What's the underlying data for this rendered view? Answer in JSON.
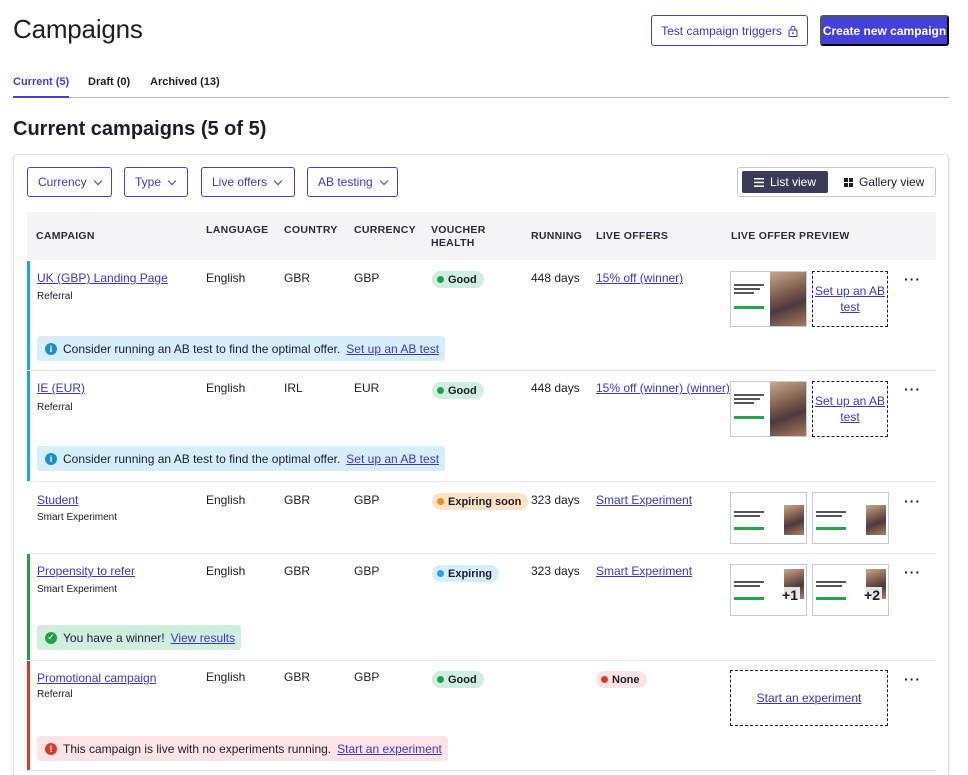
{
  "header": {
    "title": "Campaigns",
    "test_triggers_label": "Test campaign triggers",
    "create_label": "Create new campaign"
  },
  "tabs": [
    {
      "label": "Current (5)",
      "active": true
    },
    {
      "label": "Draft (0)",
      "active": false
    },
    {
      "label": "Archived (13)",
      "active": false
    }
  ],
  "section_title": "Current campaigns (5 of 5)",
  "filters": [
    {
      "label": "Currency"
    },
    {
      "label": "Type"
    },
    {
      "label": "Live offers"
    },
    {
      "label": "AB testing"
    }
  ],
  "view_toggle": {
    "list": "List view",
    "gallery": "Gallery view",
    "selected": "List view"
  },
  "columns": {
    "campaign": "CAMPAIGN",
    "language": "LANGUAGE",
    "country": "COUNTRY",
    "currency": "CURRENCY",
    "voucher_health_1": "VOUCHER",
    "voucher_health_2": "HEALTH",
    "running": "RUNNING",
    "live_offers": "LIVE OFFERS",
    "preview": "LIVE OFFER PREVIEW"
  },
  "colors": {
    "accent": "#4540d8",
    "info": "#19a7e0",
    "success": "#21a04a",
    "error": "#d93a2b",
    "warning": "#f08b1d"
  },
  "rows": [
    {
      "name": "UK (GBP) Landing Page",
      "type": "Referral",
      "language": "English",
      "country": "GBR",
      "currency": "GBP",
      "health": "Good",
      "running": "448 days",
      "offer": "15% off (winner)",
      "cta": "Set up an AB test",
      "notice": "Consider running an AB test to find the optimal offer.",
      "notice_link": "Set up an AB test"
    },
    {
      "name": "IE (EUR)",
      "type": "Referral",
      "language": "English",
      "country": "IRL",
      "currency": "EUR",
      "health": "Good",
      "running": "448 days",
      "offer": "15% off (winner) (winner)",
      "cta": "Set up an AB test",
      "notice": "Consider running an AB test to find the optimal offer.",
      "notice_link": "Set up an AB test"
    },
    {
      "name": "Student",
      "type": "Smart Experiment",
      "language": "English",
      "country": "GBR",
      "currency": "GBP",
      "health": "Expiring soon",
      "running": "323 days",
      "offer": "Smart Experiment"
    },
    {
      "name": "Propensity to refer",
      "type": "Smart Experiment",
      "language": "English",
      "country": "GBR",
      "currency": "GBP",
      "health": "Expiring",
      "running": "323 days",
      "offer": "Smart Experiment",
      "thumb1_extra": "+1",
      "thumb2_extra": "+2",
      "notice": "You have a winner!",
      "notice_link": "View results"
    },
    {
      "name": "Promotional campaign",
      "type": "Referral",
      "language": "English",
      "country": "GBR",
      "currency": "GBP",
      "health": "Good",
      "running": "",
      "offer": "None",
      "cta": "Start an experiment",
      "notice": "This campaign is live with no experiments running.",
      "notice_link": "Start an experiment"
    }
  ],
  "menu_glyph": "···",
  "icons": {
    "lock": "lock-icon",
    "info": "info-icon",
    "check": "check-circle-icon",
    "alert": "alert-icon",
    "list": "list-icon",
    "grid": "grid-icon"
  }
}
